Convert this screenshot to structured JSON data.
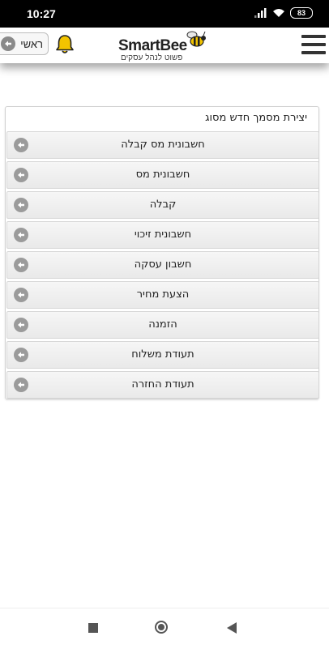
{
  "status_bar": {
    "time": "10:27",
    "battery": "83"
  },
  "header": {
    "home_label": "ראשי",
    "logo_brand": "SmartBee",
    "logo_tagline": "פשוט לנהל עסקים"
  },
  "panel": {
    "title": "יצירת מסמך חדש מסוג",
    "items": [
      {
        "label": "חשבונית מס קבלה"
      },
      {
        "label": "חשבונית מס"
      },
      {
        "label": "קבלה"
      },
      {
        "label": "חשבונית זיכוי"
      },
      {
        "label": "חשבון עסקה"
      },
      {
        "label": "הצעת מחיר"
      },
      {
        "label": "הזמנה"
      },
      {
        "label": "תעודת משלוח"
      },
      {
        "label": "תעודת החזרה"
      }
    ]
  },
  "icons": {
    "item_icon": "arrow-left-circle-icon",
    "bell": "bell-icon",
    "menu": "hamburger-menu-icon"
  },
  "colors": {
    "bell": "#f2c400",
    "accent": "#9b9b9b"
  }
}
